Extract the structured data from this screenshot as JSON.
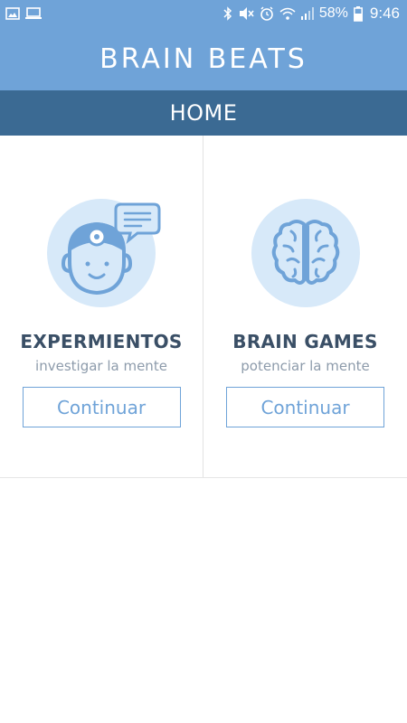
{
  "status_bar": {
    "left_icons": [
      "image-icon",
      "monitor-icon"
    ],
    "right_icons": [
      "bluetooth-icon",
      "mute-icon",
      "alarm-icon",
      "wifi-icon",
      "signal-icon",
      "battery-icon"
    ],
    "battery_percent": "58%",
    "time": "9:46"
  },
  "app_bar": {
    "title": "BRAIN BEATS"
  },
  "section": {
    "title": "HOME"
  },
  "cards": [
    {
      "icon": "doctor-head-icon",
      "title": "EXPERMIENTOS",
      "subtitle": "investigar la mente",
      "button_label": "Continuar"
    },
    {
      "icon": "brain-icon",
      "title": "BRAIN GAMES",
      "subtitle": "potenciar la mente",
      "button_label": "Continuar"
    }
  ],
  "colors": {
    "primary": "#6fa3d8",
    "header_dark": "#3b6a93",
    "icon_bg": "#d7e9f9",
    "title_text": "#3a4f66",
    "subtitle_text": "#8d9bab"
  }
}
